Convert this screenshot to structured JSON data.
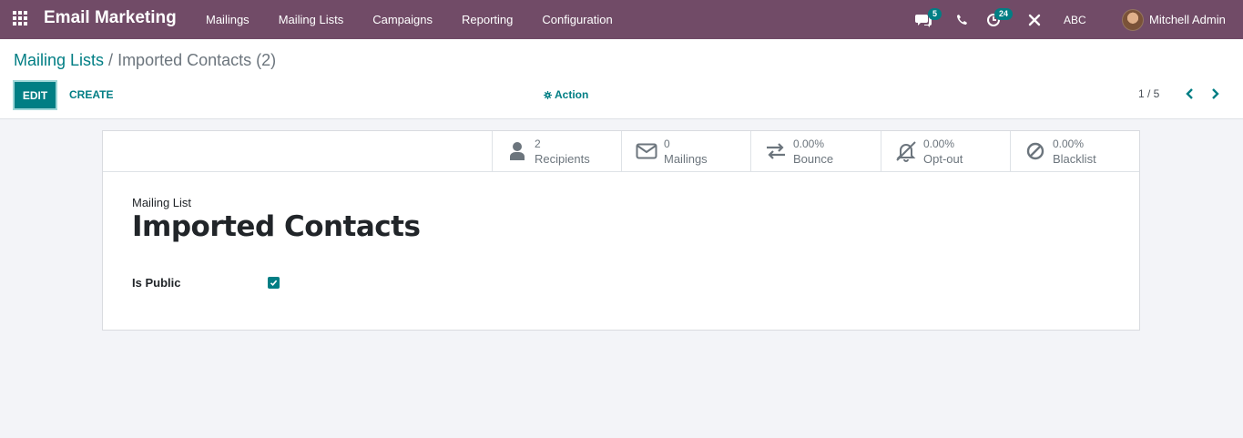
{
  "navbar": {
    "brand": "Email Marketing",
    "menu": [
      "Mailings",
      "Mailing Lists",
      "Campaigns",
      "Reporting",
      "Configuration"
    ],
    "messages_badge": "5",
    "activities_badge": "24",
    "company": "ABC",
    "user": "Mitchell Admin"
  },
  "breadcrumb": {
    "parent": "Mailing Lists",
    "separator": " / ",
    "current": "Imported Contacts (2)"
  },
  "toolbar": {
    "edit_label": "EDIT",
    "create_label": "CREATE",
    "action_label": "Action",
    "pager": "1 / 5"
  },
  "stats": [
    {
      "value": "2",
      "label": "Recipients",
      "icon": "user-icon"
    },
    {
      "value": "0",
      "label": "Mailings",
      "icon": "envelope-icon"
    },
    {
      "value": "0.00%",
      "label": "Bounce",
      "icon": "exchange-icon"
    },
    {
      "value": "0.00%",
      "label": "Opt-out",
      "icon": "bell-slash-icon"
    },
    {
      "value": "0.00%",
      "label": "Blacklist",
      "icon": "ban-icon"
    }
  ],
  "form": {
    "caption": "Mailing List",
    "title": "Imported Contacts",
    "is_public_label": "Is Public",
    "is_public": true
  },
  "colors": {
    "navbar": "#714b67",
    "accent": "#017e84"
  }
}
